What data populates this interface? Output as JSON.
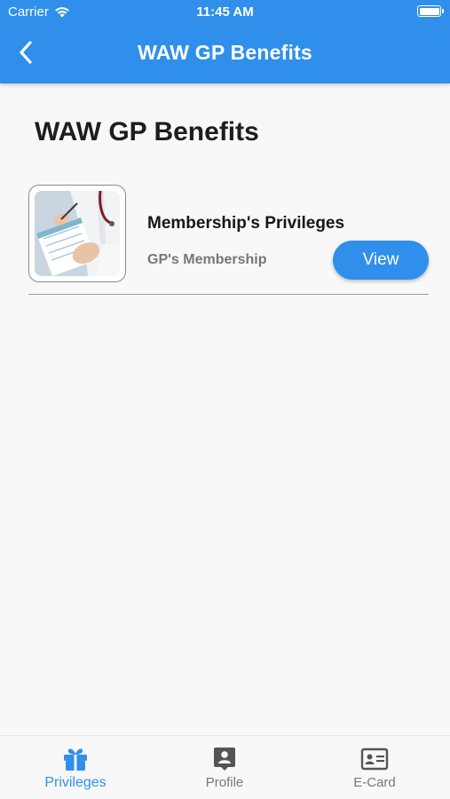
{
  "status_bar": {
    "carrier": "Carrier",
    "time": "11:45 AM"
  },
  "app_bar": {
    "title": "WAW GP Benefits",
    "back_icon": "chevron-left-icon"
  },
  "main": {
    "heading": "WAW GP Benefits",
    "items": [
      {
        "title": "Membership's Privileges",
        "subtitle": "GP's Membership",
        "action_label": "View",
        "image": "doctor-writing-prescription-photo"
      }
    ]
  },
  "bottom_nav": {
    "items": [
      {
        "label": "Privileges",
        "icon": "gift-icon",
        "active": true
      },
      {
        "label": "Profile",
        "icon": "profile-icon",
        "active": false
      },
      {
        "label": "E-Card",
        "icon": "id-card-icon",
        "active": false
      }
    ]
  },
  "colors": {
    "primary": "#2f8fea",
    "background": "#f8f8f8",
    "inactive": "#777777"
  }
}
